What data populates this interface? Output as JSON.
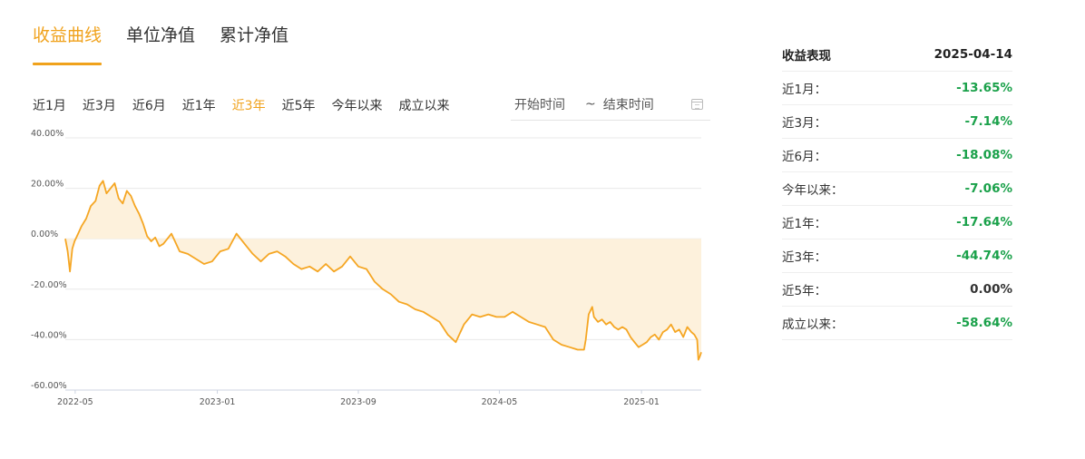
{
  "tabs": [
    {
      "label": "收益曲线",
      "active": true
    },
    {
      "label": "单位净值",
      "active": false
    },
    {
      "label": "累计净值",
      "active": false
    }
  ],
  "ranges": [
    {
      "label": "近1月",
      "active": false
    },
    {
      "label": "近3月",
      "active": false
    },
    {
      "label": "近6月",
      "active": false
    },
    {
      "label": "近1年",
      "active": false
    },
    {
      "label": "近3年",
      "active": true
    },
    {
      "label": "近5年",
      "active": false
    },
    {
      "label": "今年以来",
      "active": false
    },
    {
      "label": "成立以来",
      "active": false
    }
  ],
  "date_picker": {
    "start_placeholder": "开始时间",
    "separator": "~",
    "end_placeholder": "结束时间"
  },
  "performance": {
    "header_label": "收益表现",
    "header_date": "2025-04-14",
    "rows": [
      {
        "label": "近1月：",
        "value": "-13.65%"
      },
      {
        "label": "近3月：",
        "value": "-7.14%"
      },
      {
        "label": "近6月：",
        "value": "-18.08%"
      },
      {
        "label": "今年以来：",
        "value": "-7.06%"
      },
      {
        "label": "近1年：",
        "value": "-17.64%"
      },
      {
        "label": "近3年：",
        "value": "-44.74%"
      },
      {
        "label": "近5年：",
        "value": "0.00%"
      },
      {
        "label": "成立以来：",
        "value": "-58.64%"
      }
    ]
  },
  "colors": {
    "accent": "#f0a21c",
    "line": "#f5a623",
    "fill": "#fdf1dc",
    "negative": "#1aa14a"
  },
  "chart_data": {
    "type": "area",
    "xlim": [
      "2022-04-14",
      "2025-04-14"
    ],
    "ylim": [
      -60,
      40
    ],
    "y_ticks": [
      40,
      20,
      0,
      -20,
      -40,
      -60
    ],
    "y_tick_labels": [
      "40.00%",
      "20.00%",
      "0.00%",
      "-20.00%",
      "-40.00%",
      "-60.00%"
    ],
    "x_ticks": [
      "2022-05-01",
      "2023-01-01",
      "2023-09-01",
      "2024-05-01",
      "2025-01-01"
    ],
    "x_tick_labels": [
      "2022-05",
      "2023-01",
      "2023-09",
      "2024-05",
      "2025-01"
    ],
    "grid": true,
    "series": [
      {
        "x": [
          "2022-04-14",
          "2022-04-18",
          "2022-04-22",
          "2022-04-26",
          "2022-04-30",
          "2022-05-06",
          "2022-05-12",
          "2022-05-20",
          "2022-05-28",
          "2022-06-05",
          "2022-06-12",
          "2022-06-18",
          "2022-06-24",
          "2022-07-01",
          "2022-07-08",
          "2022-07-15",
          "2022-07-22",
          "2022-07-29",
          "2022-08-05",
          "2022-08-12",
          "2022-08-19",
          "2022-08-26",
          "2022-09-02",
          "2022-09-09",
          "2022-09-16",
          "2022-09-23",
          "2022-09-30",
          "2022-10-14",
          "2022-10-28",
          "2022-11-11",
          "2022-11-25",
          "2022-12-09",
          "2022-12-23",
          "2023-01-06",
          "2023-01-20",
          "2023-02-03",
          "2023-02-17",
          "2023-03-03",
          "2023-03-17",
          "2023-03-31",
          "2023-04-14",
          "2023-04-28",
          "2023-05-12",
          "2023-05-26",
          "2023-06-09",
          "2023-06-23",
          "2023-07-07",
          "2023-07-21",
          "2023-08-04",
          "2023-08-18",
          "2023-09-01",
          "2023-09-15",
          "2023-09-29",
          "2023-10-13",
          "2023-10-27",
          "2023-11-10",
          "2023-11-24",
          "2023-12-08",
          "2023-12-22",
          "2024-01-05",
          "2024-01-19",
          "2024-02-02",
          "2024-02-16",
          "2024-03-01",
          "2024-03-15",
          "2024-03-29",
          "2024-04-12",
          "2024-04-26",
          "2024-05-10",
          "2024-05-24",
          "2024-06-07",
          "2024-06-21",
          "2024-07-05",
          "2024-07-19",
          "2024-08-02",
          "2024-08-16",
          "2024-08-30",
          "2024-09-13",
          "2024-09-24",
          "2024-09-27",
          "2024-10-02",
          "2024-10-08",
          "2024-10-11",
          "2024-10-18",
          "2024-10-25",
          "2024-11-01",
          "2024-11-08",
          "2024-11-15",
          "2024-11-22",
          "2024-11-29",
          "2024-12-06",
          "2024-12-13",
          "2024-12-20",
          "2024-12-27",
          "2025-01-03",
          "2025-01-10",
          "2025-01-17",
          "2025-01-24",
          "2025-01-31",
          "2025-02-07",
          "2025-02-14",
          "2025-02-21",
          "2025-02-28",
          "2025-03-07",
          "2025-03-14",
          "2025-03-21",
          "2025-03-28",
          "2025-04-02",
          "2025-04-07",
          "2025-04-09",
          "2025-04-11",
          "2025-04-14"
        ],
        "values": [
          0.0,
          -5.0,
          -13.0,
          -4.0,
          -1.0,
          2.0,
          5.0,
          8.0,
          13.0,
          15.0,
          21.0,
          23.0,
          18.0,
          20.0,
          22.0,
          16.0,
          14.0,
          19.0,
          17.0,
          13.0,
          10.0,
          6.0,
          1.0,
          -1.0,
          0.5,
          -3.0,
          -2.0,
          2.0,
          -5.0,
          -6.0,
          -8.0,
          -10.0,
          -9.0,
          -5.0,
          -4.0,
          2.0,
          -2.0,
          -6.0,
          -9.0,
          -6.0,
          -5.0,
          -7.0,
          -10.0,
          -12.0,
          -11.0,
          -13.0,
          -10.0,
          -13.0,
          -11.0,
          -7.0,
          -11.0,
          -12.0,
          -17.0,
          -20.0,
          -22.0,
          -25.0,
          -26.0,
          -28.0,
          -29.0,
          -31.0,
          -33.0,
          -38.0,
          -41.0,
          -34.0,
          -30.0,
          -31.0,
          -30.0,
          -31.0,
          -31.0,
          -29.0,
          -31.0,
          -33.0,
          -34.0,
          -35.0,
          -40.0,
          -42.0,
          -43.0,
          -44.0,
          -44.0,
          -40.0,
          -30.0,
          -27.0,
          -31.0,
          -33.0,
          -32.0,
          -34.0,
          -33.0,
          -35.0,
          -36.0,
          -35.0,
          -36.0,
          -39.0,
          -41.0,
          -43.0,
          -42.0,
          -41.0,
          -39.0,
          -38.0,
          -40.0,
          -37.0,
          -36.0,
          -34.0,
          -37.0,
          -36.0,
          -39.0,
          -35.0,
          -37.0,
          -38.0,
          -40.0,
          -48.0,
          -47.0,
          -45.0
        ]
      }
    ]
  }
}
